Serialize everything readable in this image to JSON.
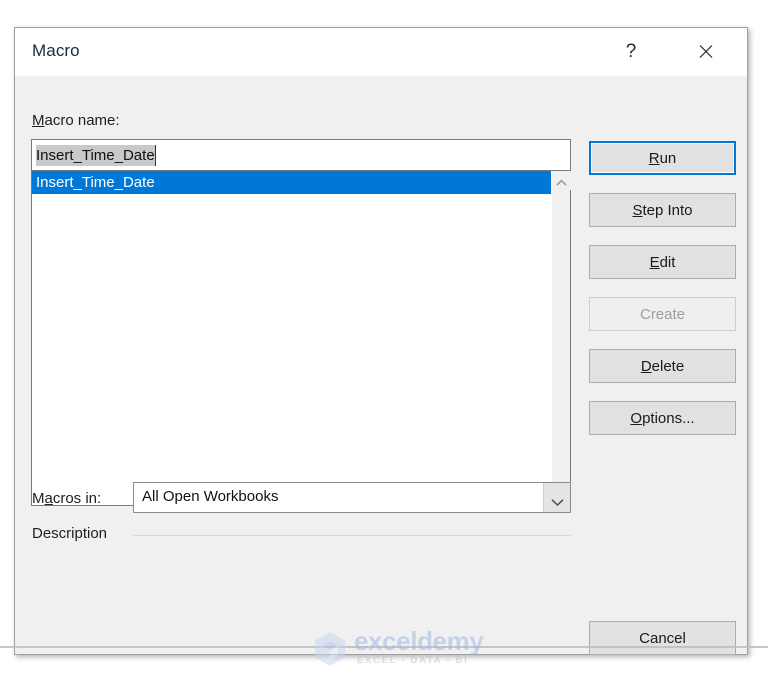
{
  "dialog": {
    "title": "Macro",
    "titlebar_buttons": [
      {
        "name": "help-button",
        "glyph": "?",
        "label": "?"
      },
      {
        "name": "close-button",
        "glyph": "close-icon",
        "label": "✕"
      }
    ]
  },
  "macro_name": {
    "label": "Macro name:",
    "accel_letter": "M",
    "label_rest": "acro name:",
    "value": "Insert_Time_Date",
    "placeholder": "",
    "selected": true,
    "caret_visible": true,
    "updown_icon": "move-up-icon"
  },
  "macro_list": {
    "items": [
      {
        "label": "Insert_Time_Date",
        "selected": true
      }
    ],
    "scrollbar": {
      "up_icon": "chevron-up-icon",
      "down_icon": "chevron-down-icon"
    }
  },
  "macros_in": {
    "label": "Macros in:",
    "accel_before": "M",
    "accel_letter": "a",
    "accel_after": "cros in:",
    "value": "All Open Workbooks",
    "options": [
      "All Open Workbooks"
    ],
    "dropdown_icon": "chevron-down-icon"
  },
  "description": {
    "label": "Description"
  },
  "buttons": [
    {
      "name": "run-button",
      "accel": "R",
      "before": "",
      "after": "un",
      "label": "Run",
      "state": "focused"
    },
    {
      "name": "step-into-button",
      "accel": "S",
      "before": "",
      "after": "tep Into",
      "label": "Step Into",
      "state": "normal"
    },
    {
      "name": "edit-button",
      "accel": "E",
      "before": "",
      "after": "dit",
      "label": "Edit",
      "state": "normal"
    },
    {
      "name": "create-button",
      "accel": "",
      "before": "Create",
      "after": "",
      "label": "Create",
      "state": "disabled"
    },
    {
      "name": "delete-button",
      "accel": "D",
      "before": "",
      "after": "elete",
      "label": "Delete",
      "state": "normal"
    },
    {
      "name": "options-button",
      "accel": "O",
      "before": "",
      "after": "ptions...",
      "label": "Options...",
      "state": "normal"
    },
    {
      "name": "cancel-button",
      "accel": "",
      "before": "Cancel",
      "after": "",
      "label": "Cancel",
      "state": "normal"
    }
  ],
  "watermark": {
    "name": "exceldemy",
    "tagline": "EXCEL - DATA - BI",
    "logo_icon": "cube-logo-icon",
    "brand_color": "#9fb6e4"
  },
  "colors": {
    "dialog_background": "#f0f0f0",
    "titlebar_background": "#ffffff",
    "selection_blue": "#0078d7",
    "text_selection_gray": "#c9c9c9",
    "button_face": "#e1e1e1",
    "disabled_text": "#9d9d9d"
  }
}
